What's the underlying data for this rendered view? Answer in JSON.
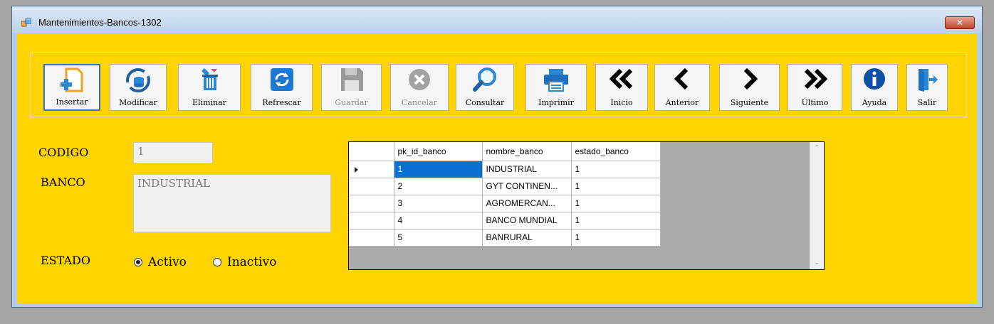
{
  "window": {
    "title": "Mantenimientos-Bancos-1302",
    "close_glyph": "✕"
  },
  "toolbar": {
    "buttons": [
      {
        "label": "Insertar",
        "icon": "insert-icon",
        "state": "active"
      },
      {
        "label": "Modificar",
        "icon": "modify-icon",
        "state": "enabled"
      },
      {
        "label": "Eliminar",
        "icon": "delete-icon",
        "state": "enabled"
      },
      {
        "label": "Refrescar",
        "icon": "refresh-icon",
        "state": "enabled"
      },
      {
        "label": "Guardar",
        "icon": "save-icon",
        "state": "disabled"
      },
      {
        "label": "Cancelar",
        "icon": "cancel-icon",
        "state": "disabled"
      },
      {
        "label": "Consultar",
        "icon": "search-icon",
        "state": "enabled"
      },
      {
        "label": "Imprimir",
        "icon": "printer-icon",
        "state": "enabled"
      },
      {
        "label": "Inicio",
        "icon": "double-chevron-left-icon",
        "state": "enabled"
      },
      {
        "label": "Anterior",
        "icon": "chevron-left-icon",
        "state": "enabled"
      },
      {
        "label": "Siguiente",
        "icon": "chevron-right-icon",
        "state": "enabled"
      },
      {
        "label": "Último",
        "icon": "double-chevron-right-icon",
        "state": "enabled"
      },
      {
        "label": "Ayuda",
        "icon": "info-icon",
        "state": "enabled"
      },
      {
        "label": "Salir",
        "icon": "exit-icon",
        "state": "enabled"
      }
    ]
  },
  "form": {
    "codigo_label": "CODIGO",
    "codigo_value": "1",
    "banco_label": "BANCO",
    "banco_value": "INDUSTRIAL",
    "estado_label": "ESTADO",
    "estado_options": [
      {
        "label": "Activo",
        "selected": true
      },
      {
        "label": "Inactivo",
        "selected": false
      }
    ]
  },
  "grid": {
    "columns": [
      "pk_id_banco",
      "nombre_banco",
      "estado_banco"
    ],
    "rows": [
      [
        "1",
        "INDUSTRIAL",
        "1"
      ],
      [
        "2",
        "GYT CONTINEN...",
        "1"
      ],
      [
        "3",
        "AGROMERCAN...",
        "1"
      ],
      [
        "4",
        "BANCO MUNDIAL",
        "1"
      ],
      [
        "5",
        "BANRURAL",
        "1"
      ]
    ],
    "current_row": 0,
    "scroll_up": "⌃",
    "scroll_down": "⌄"
  },
  "colors": {
    "client_bg": "#ffd400",
    "selection": "#0a70d4",
    "active_button_border": "#2f74d0"
  }
}
